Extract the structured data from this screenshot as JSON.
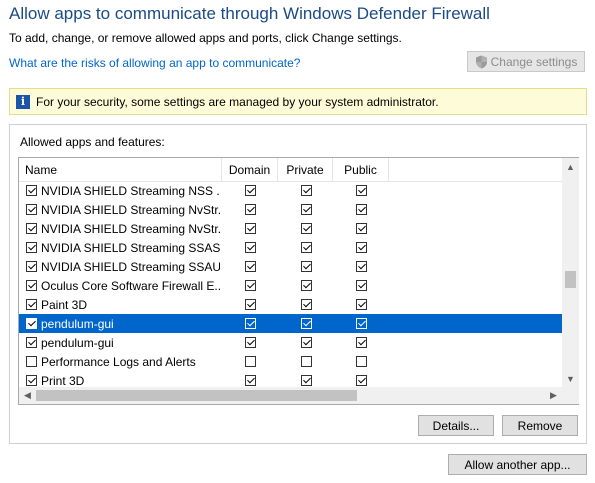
{
  "header": {
    "title": "Allow apps to communicate through Windows Defender Firewall",
    "subtitle": "To add, change, or remove allowed apps and ports, click Change settings.",
    "risk_link": "What are the risks of allowing an app to communicate?",
    "change_settings_label": "Change settings"
  },
  "infobar": {
    "icon": "info-icon",
    "text": "For your security, some settings are managed by your system administrator."
  },
  "apps_group": {
    "label": "Allowed apps and features:",
    "columns": [
      "Name",
      "Domain",
      "Private",
      "Public"
    ],
    "rows": [
      {
        "name": "NVIDIA SHIELD Streaming NSS ...",
        "enabled": true,
        "domain": true,
        "private": true,
        "public": true,
        "selected": false
      },
      {
        "name": "NVIDIA SHIELD Streaming NvStr...",
        "enabled": true,
        "domain": true,
        "private": true,
        "public": true,
        "selected": false
      },
      {
        "name": "NVIDIA SHIELD Streaming NvStr...",
        "enabled": true,
        "domain": true,
        "private": true,
        "public": true,
        "selected": false
      },
      {
        "name": "NVIDIA SHIELD Streaming SSAS ...",
        "enabled": true,
        "domain": true,
        "private": true,
        "public": true,
        "selected": false
      },
      {
        "name": "NVIDIA SHIELD Streaming SSAU ...",
        "enabled": true,
        "domain": true,
        "private": true,
        "public": true,
        "selected": false
      },
      {
        "name": "Oculus Core Software Firewall E...",
        "enabled": true,
        "domain": true,
        "private": true,
        "public": true,
        "selected": false
      },
      {
        "name": "Paint 3D",
        "enabled": true,
        "domain": true,
        "private": true,
        "public": true,
        "selected": false
      },
      {
        "name": "pendulum-gui",
        "enabled": true,
        "domain": true,
        "private": true,
        "public": true,
        "selected": true
      },
      {
        "name": "pendulum-gui",
        "enabled": true,
        "domain": true,
        "private": true,
        "public": true,
        "selected": false
      },
      {
        "name": "Performance Logs and Alerts",
        "enabled": false,
        "domain": false,
        "private": false,
        "public": false,
        "selected": false
      },
      {
        "name": "Print 3D",
        "enabled": true,
        "domain": true,
        "private": true,
        "public": true,
        "selected": false
      }
    ],
    "details_label": "Details...",
    "remove_label": "Remove"
  },
  "allow_another_label": "Allow another app...",
  "colors": {
    "title": "#1a4b86",
    "link": "#0066cc",
    "selection": "#0066cc",
    "infobar_bg": "#fefcd8"
  }
}
